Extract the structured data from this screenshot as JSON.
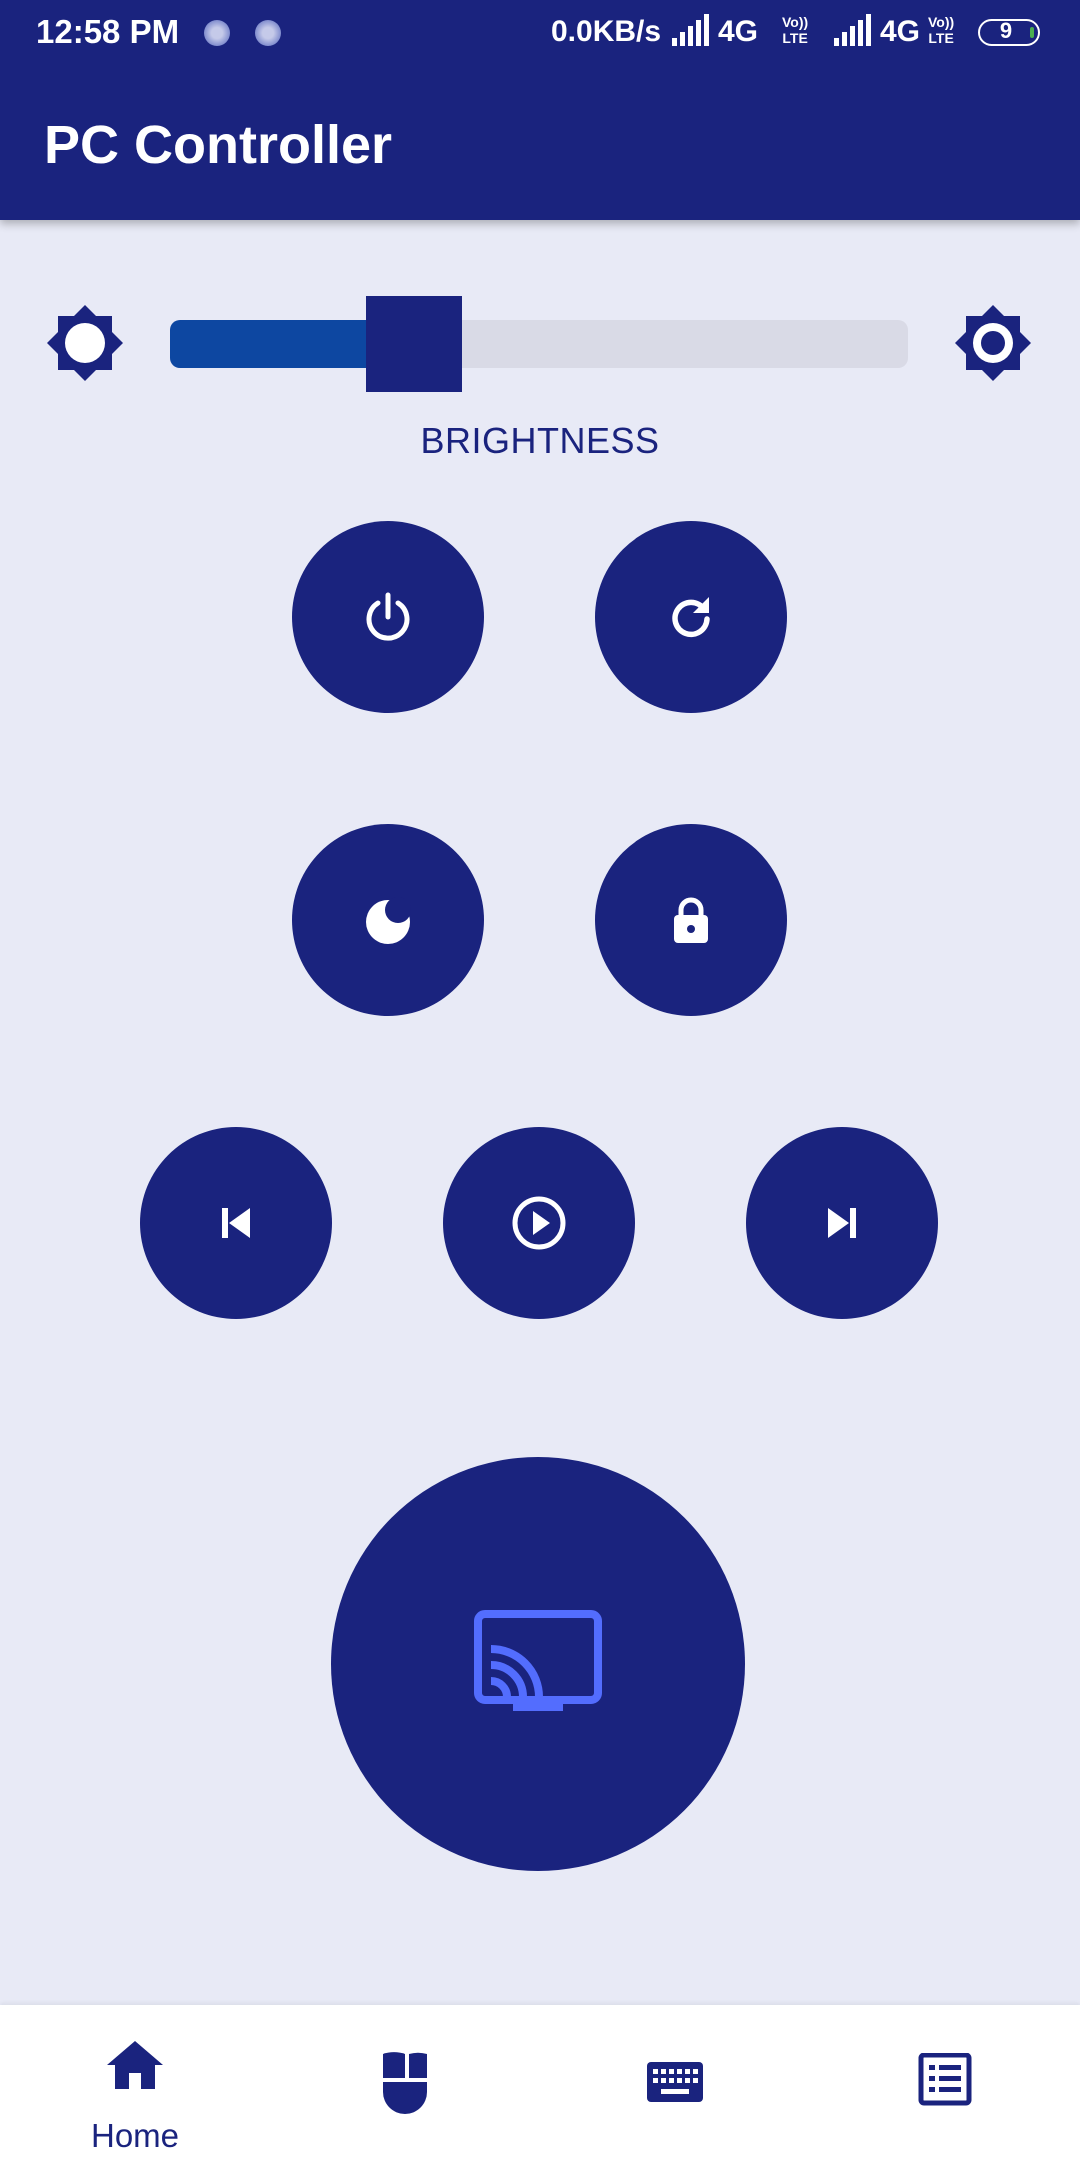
{
  "status_bar": {
    "time": "12:58 PM",
    "data_rate": "0.0KB/s",
    "network1": "4G",
    "network2": "4G",
    "volte_top": "Vo))",
    "volte_bottom": "LTE",
    "battery_level": "9"
  },
  "app_bar": {
    "title": "PC Controller"
  },
  "brightness": {
    "label": "BRIGHTNESS",
    "level_fraction": 0.33,
    "low_icon": "brightness-low-icon",
    "high_icon": "brightness-high-icon"
  },
  "controls": {
    "power": "power-icon",
    "restart": "restart-icon",
    "sleep": "sleep-moon-icon",
    "lock": "lock-icon",
    "previous": "skip-previous-icon",
    "play_pause": "play-circle-icon",
    "next": "skip-next-icon",
    "cast": "cast-screen-icon"
  },
  "bottom_nav": {
    "items": [
      {
        "label": "Home",
        "icon": "home-icon",
        "active": true
      },
      {
        "label": "",
        "icon": "mouse-icon",
        "active": false
      },
      {
        "label": "",
        "icon": "keyboard-icon",
        "active": false
      },
      {
        "label": "",
        "icon": "list-icon",
        "active": false
      }
    ]
  },
  "colors": {
    "primary": "#1a237e",
    "background": "#e8eaf6",
    "slider_fill": "#0d47a1",
    "slider_track": "#d9dae6",
    "cast_accent": "#536dfe"
  }
}
